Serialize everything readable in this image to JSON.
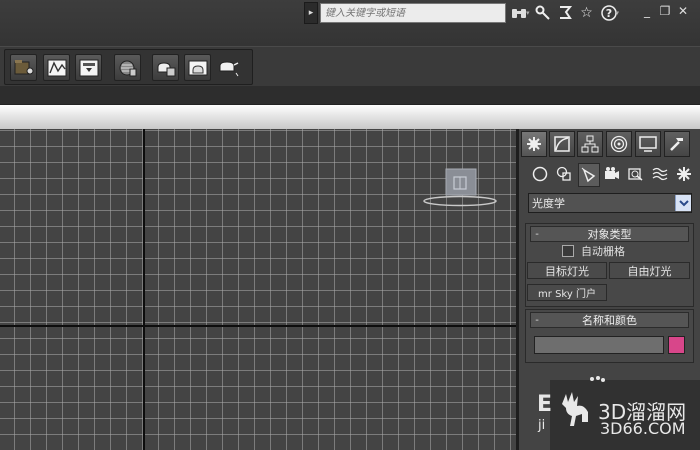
{
  "search": {
    "placeholder": "键入关键字或短语"
  },
  "toolbar_top": {
    "icons": [
      "binoculars-icon",
      "wrench-icon",
      "communication-center-icon",
      "star-icon",
      "help-icon"
    ]
  },
  "window_controls": {
    "minimize": "_",
    "restore": "❐",
    "close": "✕"
  },
  "command_panel": {
    "tabs": [
      "create-tab",
      "modify-tab",
      "hierarchy-tab",
      "motion-tab",
      "display-tab",
      "utilities-tab"
    ],
    "subcategories": [
      "geometry",
      "shapes",
      "lights",
      "cameras",
      "helpers",
      "space-warps",
      "systems"
    ],
    "category_dropdown": {
      "value": "光度学"
    },
    "object_type_rollout": {
      "minus": "-",
      "title": "对象类型",
      "autogrid_label": "自动栅格",
      "autogrid_checked": false,
      "buttons": [
        "目标灯光",
        "自由灯光",
        "mr Sky 门户"
      ]
    },
    "name_color_rollout": {
      "minus": "-",
      "title": "名称和颜色",
      "name_value": "",
      "color": "#d8468a"
    }
  },
  "viewport": {
    "object": "photometric-light-object"
  },
  "watermark": {
    "line1": "3D溜溜网",
    "line2": "3D66.COM",
    "partial1": "E",
    "partial2": "ji"
  },
  "colors": {
    "swatch": "#d8468a",
    "viewport_bg": "#444444",
    "panel_bg": "#444444"
  }
}
